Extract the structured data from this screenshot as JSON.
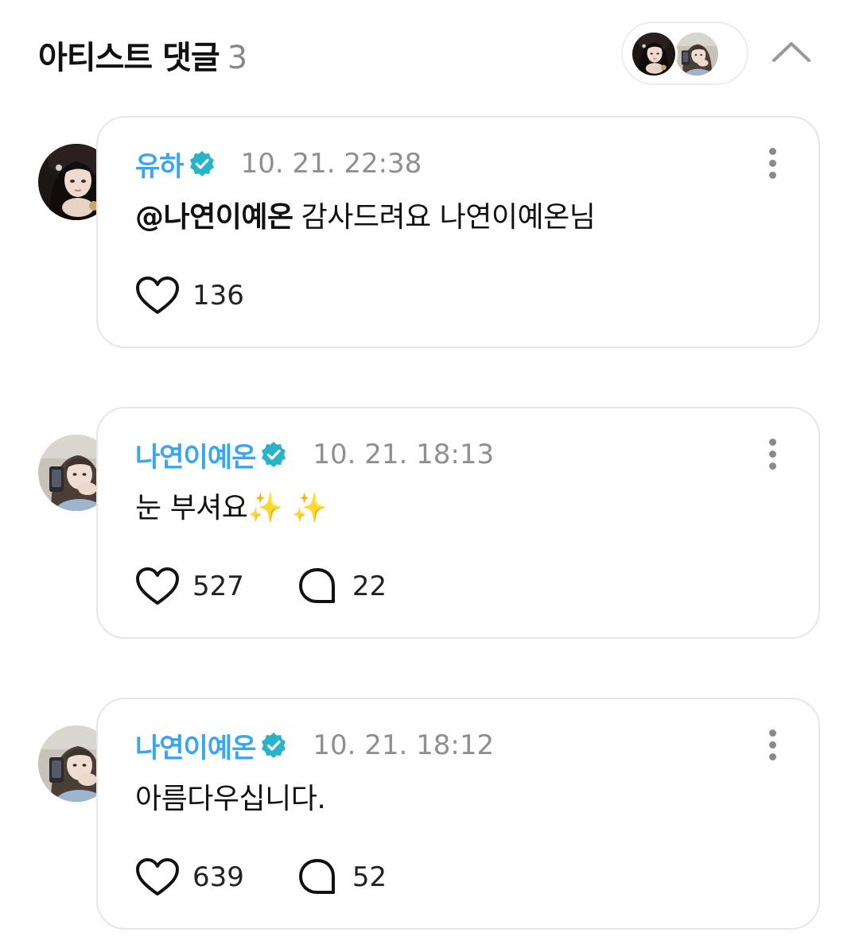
{
  "header": {
    "title": "아티스트 댓글",
    "count": "3"
  },
  "comments": [
    {
      "author": "유하",
      "date": "10. 21. 22:38",
      "mention": "@나연이예온",
      "text": "감사드려요 나연이예온님",
      "likes": "136",
      "replies": ""
    },
    {
      "author": "나연이예온",
      "date": "10. 21. 18:13",
      "mention": "",
      "text": "눈 부셔요✨ ✨",
      "likes": "527",
      "replies": "22"
    },
    {
      "author": "나연이예온",
      "date": "10. 21. 18:12",
      "mention": "",
      "text": "아름다우십니다.",
      "likes": "639",
      "replies": "52"
    }
  ],
  "colors": {
    "author": "#3aa6f0",
    "verified": "#29b3c9",
    "date": "#8f8f8f",
    "border": "#e6e6e6"
  },
  "icons": {
    "verified": "verified-badge-icon",
    "like": "heart-icon",
    "reply": "speech-bubble-icon",
    "more": "more-vertical-icon",
    "collapse": "chevron-up-icon"
  }
}
